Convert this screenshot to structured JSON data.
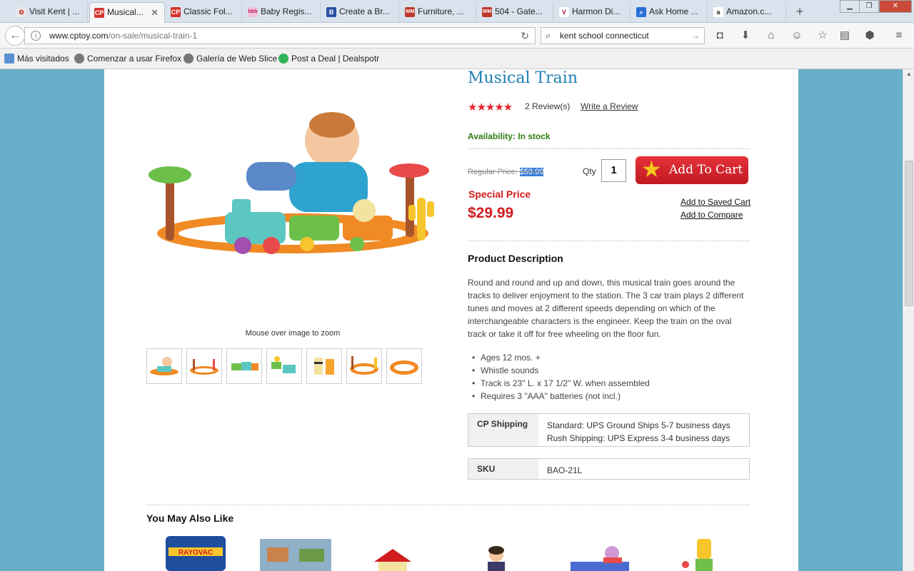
{
  "browser": {
    "tabs": [
      {
        "label": "Visit Kent | ...",
        "icon_color": "#c0392b",
        "icon_text": ""
      },
      {
        "label": "Musical...",
        "icon_color": "#d6322a",
        "icon_text": "CP",
        "active": true
      },
      {
        "label": "Classic Fol...",
        "icon_color": "#d6322a",
        "icon_text": "CP"
      },
      {
        "label": "Baby Regis...",
        "icon_color": "#e8a0c8",
        "icon_text": "bbb"
      },
      {
        "label": "Create a Br...",
        "icon_color": "#2b4fa3",
        "icon_text": "B"
      },
      {
        "label": "Furniture, ...",
        "icon_color": "#c0392b",
        "icon_text": "WM"
      },
      {
        "label": "504 - Gate...",
        "icon_color": "#c0392b",
        "icon_text": "WM"
      },
      {
        "label": "Harmon Di...",
        "icon_color": "#b0185c",
        "icon_text": "V"
      },
      {
        "label": "Ask Home ...",
        "icon_color": "#2a6fd6",
        "icon_text": "Q"
      },
      {
        "label": "Amazon.c...",
        "icon_color": "#222222",
        "icon_text": "a"
      }
    ],
    "url_domain": "www.cptoy.com",
    "url_path": "/on-sale/musical-train-1",
    "search_value": "kent school connecticut",
    "bookmarks": [
      {
        "label": "Más visitados",
        "icon_color": "#5a8fd0"
      },
      {
        "label": "Comenzar a usar Firefox",
        "icon_color": "#777777"
      },
      {
        "label": "Galería de Web Slice",
        "icon_color": "#777777"
      },
      {
        "label": "Post a Deal | Dealspotr",
        "icon_color": "#2fb45a"
      }
    ]
  },
  "product": {
    "title": "Musical Train",
    "rating": 5,
    "stars": "★★★★★",
    "review_count": "2 Review(s)",
    "write_review": "Write a Review",
    "availability": "Availability: In stock",
    "regular_label": "Regular Price: ",
    "regular_price": "$59.99",
    "special_label": "Special Price",
    "special_price": "$29.99",
    "qty_label": "Qty",
    "qty_value": "1",
    "add_to_cart": "Add To Cart",
    "add_saved_cart": "Add to Saved Cart",
    "add_compare": "Add to Compare",
    "zoom_note": "Mouse over image to zoom",
    "desc_title": "Product Description",
    "description": "Round and round and up and down, this musical train goes around the tracks to deliver enjoyment to the station. The 3 car train plays 2 different tunes and moves at 2 different speeds depending on which of the interchangeable characters is the engineer. Keep the train on the oval track or take it off for free wheeling on the floor fun.",
    "features": [
      "Ages 12 mos. +",
      "Whistle sounds",
      "Track is 23\" L. x 17 1/2\" W. when assembled",
      "Requires 3 \"AAA\" batteries (not incl.)"
    ],
    "shipping_label": "CP Shipping",
    "shipping_standard": "Standard: UPS Ground Ships 5-7 business days",
    "shipping_rush": "Rush Shipping: UPS Express 3-4 business days",
    "sku_label": "SKU",
    "sku_value": "BAO-21L"
  },
  "related_title": "You May Also Like"
}
